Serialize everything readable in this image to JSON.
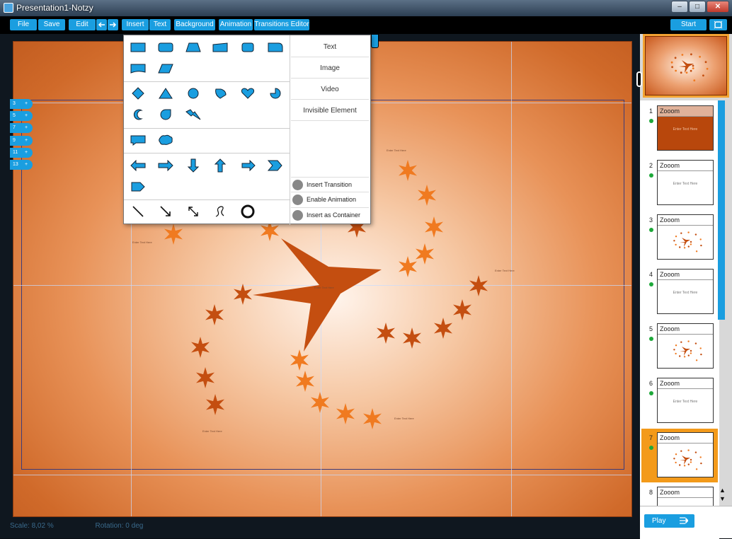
{
  "window": {
    "title": "Presentation1-Notzy"
  },
  "toolbar": {
    "file": "File",
    "save": "Save",
    "edit": "Edit",
    "insert": "Insert",
    "text": "Text",
    "background": "Background",
    "animation": "Animation",
    "transitions_editor": "Transitions Editor",
    "start": "Start"
  },
  "layers": [
    "3",
    "5",
    "7",
    "9",
    "11",
    "13"
  ],
  "layer_add": "+",
  "insert_menu": {
    "items": [
      "Text",
      "Image",
      "Video",
      "Invisible Element"
    ],
    "toggles": [
      "Insert Transition",
      "Enable Animation",
      "Insert as Container"
    ]
  },
  "status": {
    "scale": "Scale: 8,02 %",
    "rotation": "Rotation: 0 deg"
  },
  "slide": {
    "placeholder": "Enter Text Here",
    "colors": {
      "accent": "#c85010",
      "light_star": "#f07a20"
    }
  },
  "slides": [
    {
      "num": "1",
      "title": "Zooom",
      "type": "title-dark"
    },
    {
      "num": "2",
      "title": "Zooom",
      "type": "text",
      "text": "Enter Text Here"
    },
    {
      "num": "3",
      "title": "Zooom",
      "type": "stars"
    },
    {
      "num": "4",
      "title": "Zooom",
      "type": "text",
      "text": "Enter Text Here"
    },
    {
      "num": "5",
      "title": "Zooom",
      "type": "stars"
    },
    {
      "num": "6",
      "title": "Zooom",
      "type": "text",
      "text": "Enter Text Here"
    },
    {
      "num": "7",
      "title": "Zooom",
      "type": "stars",
      "active": true
    },
    {
      "num": "8",
      "title": "Zooom",
      "type": "text"
    }
  ],
  "play": {
    "label": "Play"
  },
  "colors": {
    "accent": "#1a9ee0",
    "active_slide": "#f39a1a",
    "status_dot": "#1ea83a"
  }
}
